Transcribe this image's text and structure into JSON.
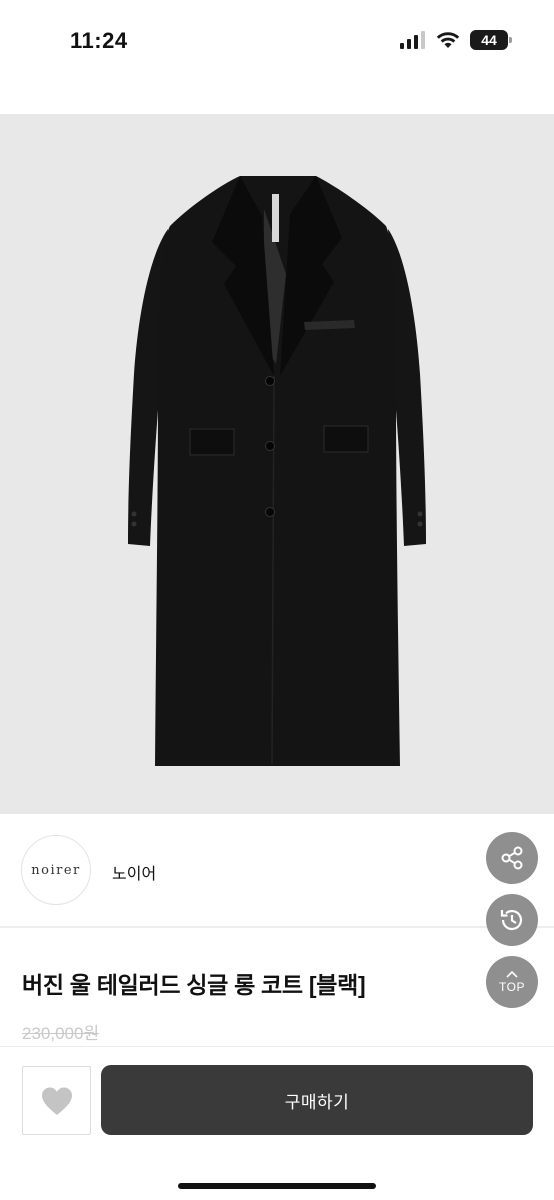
{
  "status_bar": {
    "time": "11:24",
    "battery": "44",
    "icons": [
      "signal-icon",
      "wifi-icon",
      "battery-icon"
    ]
  },
  "product": {
    "image_icon": "black-long-coat",
    "title": "버진 울 테일러드 싱글 롱 코트 [블랙]",
    "price": "230,000원"
  },
  "seller": {
    "logo_text": "noirer",
    "name": "노이어"
  },
  "floating_actions": {
    "share_icon": "share-icon",
    "recent_icon": "history-icon",
    "top_label": "TOP"
  },
  "bottom_bar": {
    "like_icon": "heart-icon",
    "buy_label": "구매하기"
  },
  "colors": {
    "buy_button": "#3a3a3a",
    "fab": "#8f8f8f",
    "image_bg": "#e8e8e8",
    "price_strikethrough": "#c9c9c9"
  }
}
